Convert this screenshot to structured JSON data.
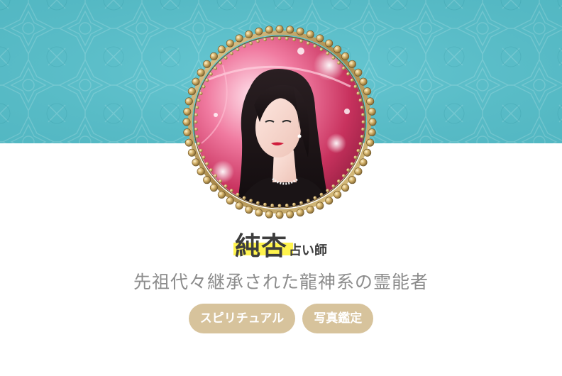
{
  "profile": {
    "name": "純杏",
    "role": "占い師",
    "tagline": "先祖代々継承された龍神系の霊能者",
    "avatar": "fortune-teller-portrait"
  },
  "tags": [
    {
      "label": "スピリチュアル"
    },
    {
      "label": "写真鑑定"
    }
  ],
  "colors": {
    "banner": "#58c3cf",
    "tag_background": "#d7c39c",
    "name_highlight": "#fff34d",
    "name_text": "#3d3d3d",
    "tagline_text": "#8c8c8c",
    "frame_gold": "#b89a5a"
  },
  "icons": {
    "banner_pattern": "geometric-star-pattern",
    "avatar_frame": "gold-beaded-frame"
  }
}
